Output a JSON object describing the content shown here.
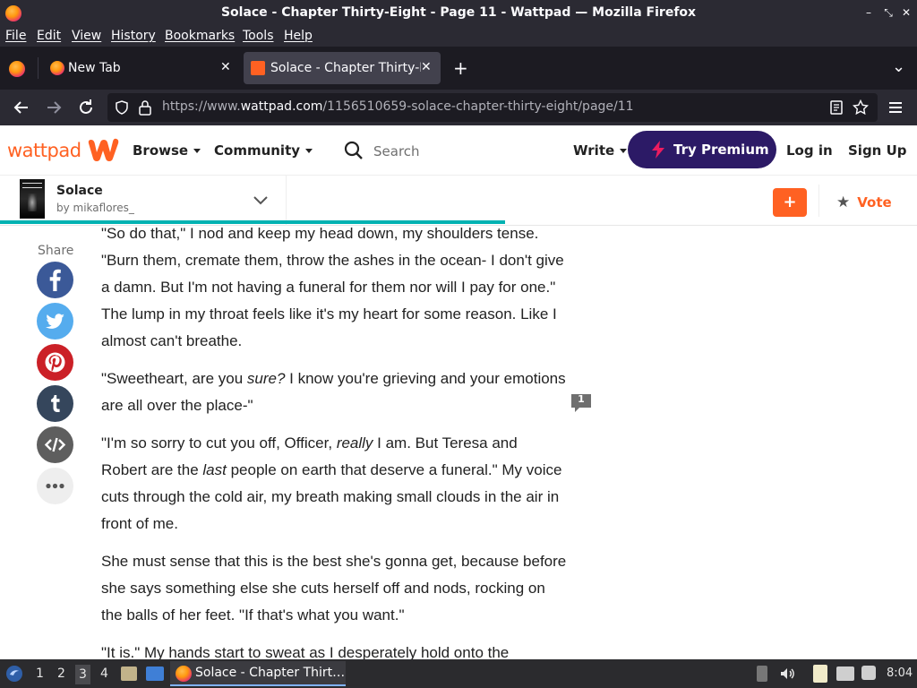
{
  "window": {
    "title": "Solace - Chapter Thirty-Eight - Page 11 - Wattpad — Mozilla Firefox",
    "minimize_glyph": "–",
    "restore_glyph": "⤡",
    "close_glyph": "✕"
  },
  "menu": {
    "file": "File",
    "edit": "Edit",
    "view": "View",
    "history": "History",
    "bookmarks": "Bookmarks",
    "tools": "Tools",
    "help": "Help"
  },
  "tabs": [
    {
      "label": "New Tab",
      "close": "✕"
    },
    {
      "label": "Solace - Chapter Thirty-E",
      "close": "✕"
    }
  ],
  "new_tab_glyph": "+",
  "list_tabs_glyph": "⌄",
  "nav": {
    "url_prefix": "https://www.",
    "url_domain": "wattpad.com",
    "url_path": "/1156510659-solace-chapter-thirty-eight/page/11"
  },
  "wattpad": {
    "logo": "wattpad",
    "browse": "Browse",
    "community": "Community",
    "search_placeholder": "Search",
    "write": "Write",
    "premium": "Try Premium",
    "login": "Log in",
    "signup": "Sign Up"
  },
  "story": {
    "title": "Solace",
    "author": "by mikaflores_",
    "add_label": "+",
    "vote_label": "Vote",
    "progress_fraction": 0.551
  },
  "share": {
    "label": "Share"
  },
  "reading": {
    "p1": "\"So do that,\" I nod and keep my head down, my shoulders tense. \"Burn them, cremate them, throw the ashes in the ocean- I don't give a damn. But I'm not having a funeral for them nor will I pay for one.\" The lump in my throat feels like it's my heart for some reason. Like I almost can't breathe.",
    "p2a": "\"Sweetheart, are you ",
    "p2b": "sure?",
    "p2c": " I know you're grieving and your emotions are all over the place-\"",
    "p3a": "\"I'm so sorry to cut you off, Officer, ",
    "p3b": "really",
    "p3c": " I am. But Teresa and Robert are the ",
    "p3d": "last",
    "p3e": " people on earth that deserve a funeral.\" My voice cuts through the cold air, my breath making small clouds in the air in front of me.",
    "p4": "She must sense that this is the best she's gonna get, because before she says something else she cuts herself off and nods, rocking on the balls of her feet. \"If that's what you want.\"",
    "p5": "\"It is.\" My hands start to sweat as I desperately hold onto the",
    "comment_count": "1"
  },
  "taskbar": {
    "workspaces": [
      "1",
      "2",
      "3",
      "4"
    ],
    "active_window": "Solace - Chapter Thirt…",
    "clock": "8:04"
  },
  "colors": {
    "wattpad_orange": "#ff6122",
    "premium_purple": "#2c1a66",
    "progress_teal": "#00b2b2",
    "facebook": "#3b5998",
    "twitter": "#55acee",
    "pinterest": "#cb2027",
    "tumblr": "#35465c",
    "embed": "#5e5e5e"
  }
}
